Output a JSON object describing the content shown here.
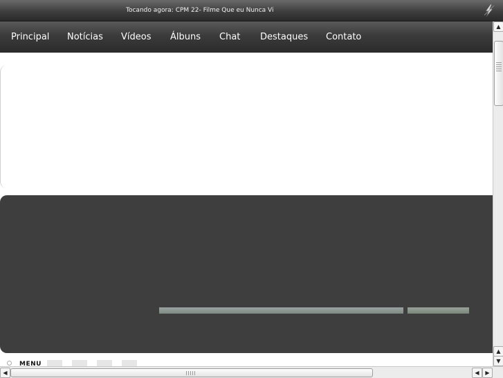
{
  "now_playing": {
    "label": "Tocando agora:",
    "track": "CPM 22- Filme Que eu Nunca Vi"
  },
  "icons": {
    "logo": "lightning-logo-icon",
    "scroll_up": "arrow-up-icon",
    "scroll_down": "arrow-down-icon",
    "scroll_left": "arrow-left-icon",
    "scroll_right": "arrow-right-icon"
  },
  "nav": {
    "items": [
      {
        "label": "Principal"
      },
      {
        "label": "Notícias"
      },
      {
        "label": "Vídeos"
      },
      {
        "label": "Álbuns"
      },
      {
        "label": "Chat"
      },
      {
        "label": "Destaques"
      },
      {
        "label": "Contato"
      }
    ]
  },
  "menu_strip": {
    "label": "MENU"
  },
  "colors": {
    "bar_dark": "#2b2b2b",
    "panel": "#3e3e3e",
    "nav_text": "#ffffff",
    "page": "#ffffff"
  }
}
